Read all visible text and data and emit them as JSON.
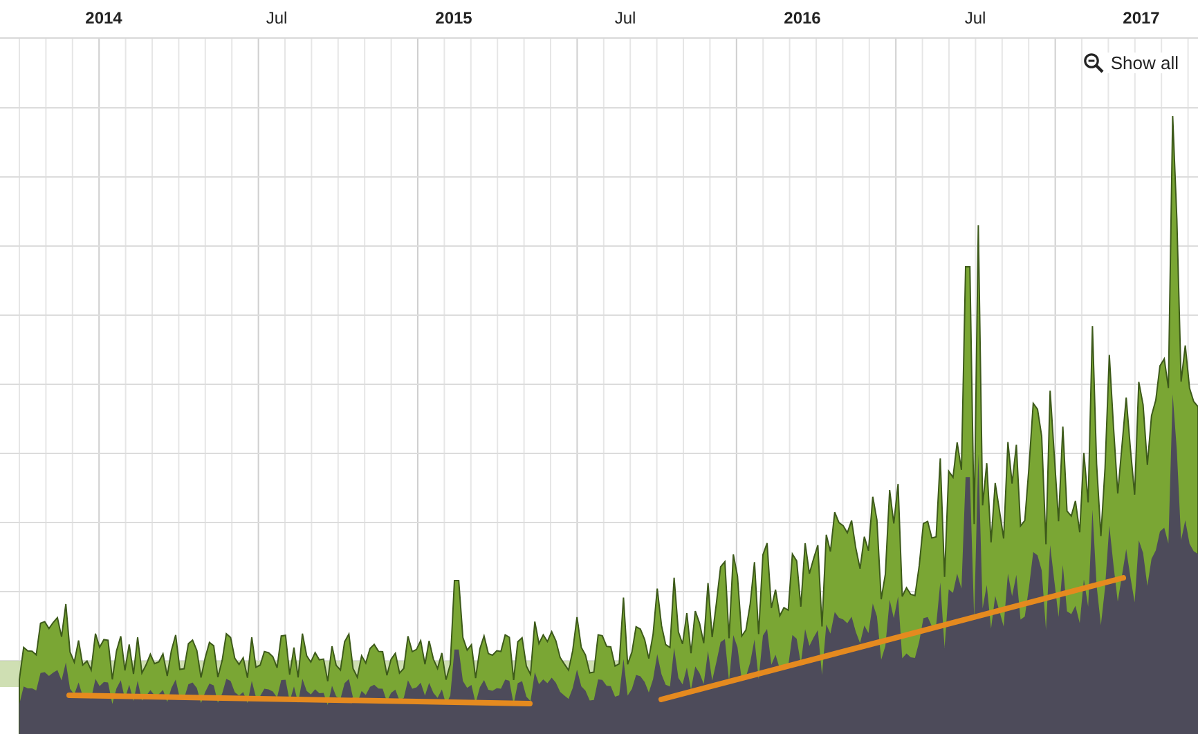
{
  "axis_labels": [
    {
      "text": "2014",
      "kind": "year"
    },
    {
      "text": "Jul",
      "kind": "month"
    },
    {
      "text": "2015",
      "kind": "year"
    },
    {
      "text": "Jul",
      "kind": "month"
    },
    {
      "text": "2016",
      "kind": "year"
    },
    {
      "text": "Jul",
      "kind": "month"
    },
    {
      "text": "2017",
      "kind": "year"
    }
  ],
  "show_all": {
    "label": "Show all"
  }
}
